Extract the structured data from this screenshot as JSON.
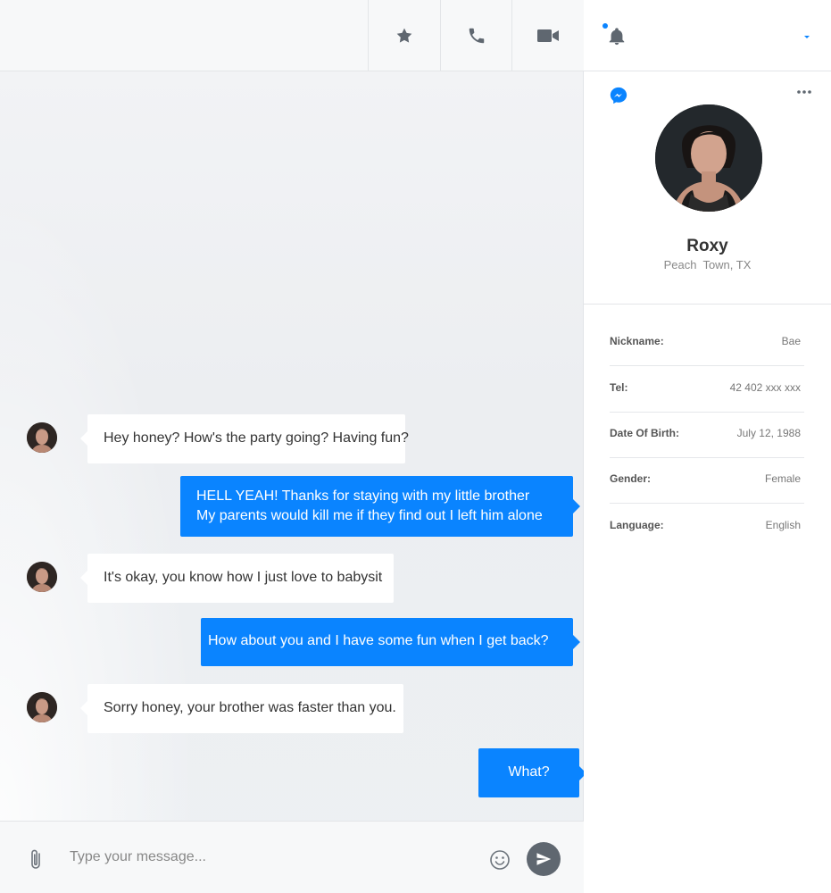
{
  "header": {
    "star_icon": "star-icon",
    "call_icon": "phone-icon",
    "video_icon": "video-camera-icon",
    "notifications_icon": "bell-icon",
    "dropdown_icon": "caret-down-icon",
    "accent_color": "#0a84ff"
  },
  "messages": [
    {
      "direction": "incoming",
      "lines": [
        "Hey honey? How's the party going? Having fun?"
      ]
    },
    {
      "direction": "outgoing",
      "lines": [
        "HELL YEAH! Thanks for staying with my little brother",
        "My parents would kill me if they find out I left him alone"
      ]
    },
    {
      "direction": "incoming",
      "lines": [
        "It's okay, you know how I just love to babysit"
      ]
    },
    {
      "direction": "outgoing",
      "lines": [
        "How about you and I have some fun when I get back?"
      ]
    },
    {
      "direction": "incoming",
      "lines": [
        "Sorry honey, your brother was faster than you."
      ]
    },
    {
      "direction": "outgoing",
      "lines": [
        "What?"
      ]
    }
  ],
  "composer": {
    "placeholder": "Type your message...",
    "value": "",
    "attach_icon": "paperclip-icon",
    "emoji_icon": "smiley-icon",
    "send_icon": "send-icon"
  },
  "profile": {
    "messenger_icon": "messenger-icon",
    "more_icon": "more-horizontal-icon",
    "name": "Roxy",
    "location": "Peach  Town, TX",
    "details": [
      {
        "label": "Nickname:",
        "value": "Bae"
      },
      {
        "label": "Tel:",
        "value": "42 402 xxx xxx"
      },
      {
        "label": "Date Of Birth:",
        "value": "July 12, 1988"
      },
      {
        "label": "Gender:",
        "value": "Female"
      },
      {
        "label": "Language:",
        "value": "English"
      }
    ]
  }
}
